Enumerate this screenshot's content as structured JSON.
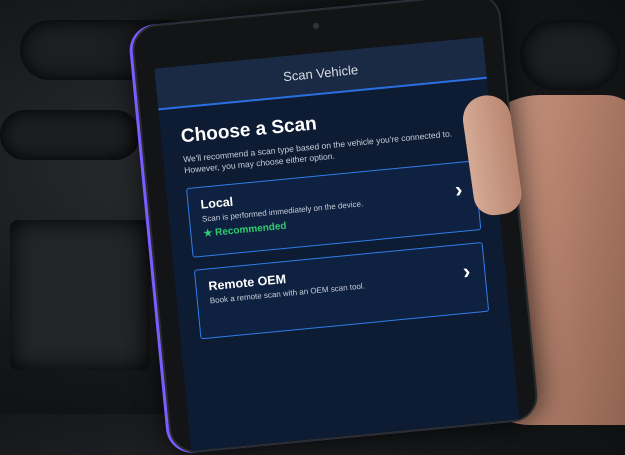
{
  "app": {
    "title": "Scan Vehicle"
  },
  "main": {
    "heading": "Choose a Scan",
    "subtext": "We'll recommend a scan type based on the vehicle you're connected to. However, you may choose either option.",
    "options": [
      {
        "title": "Local",
        "description": "Scan is performed immediately on the device.",
        "badge": "Recommended",
        "icon": "chevron-right-icon"
      },
      {
        "title": "Remote OEM",
        "description": "Book a remote scan with an OEM scan tool.",
        "icon": "chevron-right-icon"
      }
    ]
  },
  "colors": {
    "accent": "#2f7de8",
    "recommended": "#2ecc71",
    "background": "#0d1b33"
  }
}
